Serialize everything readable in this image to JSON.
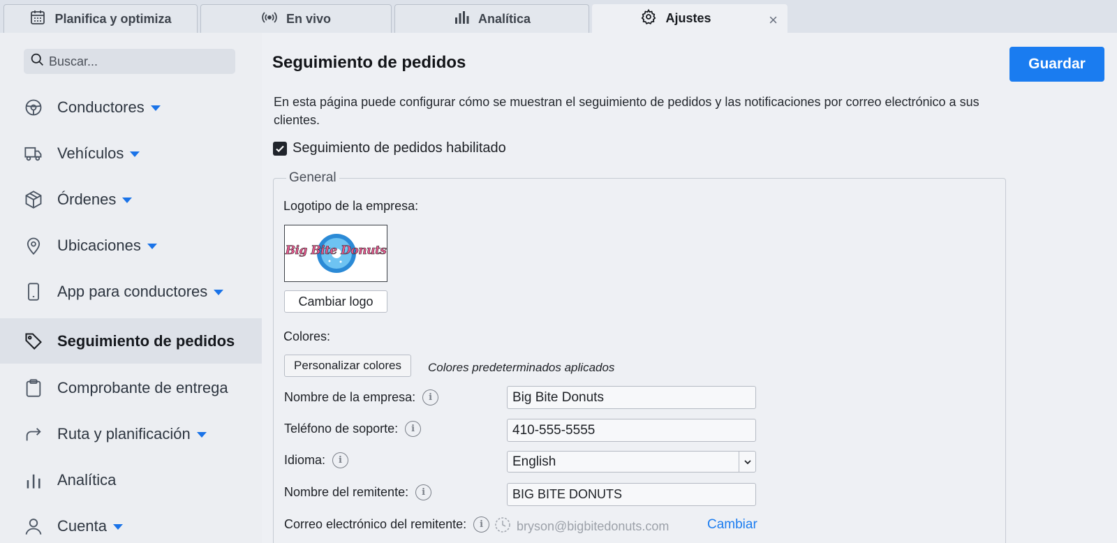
{
  "tabs": [
    {
      "label": "Planifica y optimiza",
      "icon": "calendar-icon"
    },
    {
      "label": "En vivo",
      "icon": "broadcast-icon"
    },
    {
      "label": "Analítica",
      "icon": "bar-chart-icon"
    },
    {
      "label": "Ajustes",
      "icon": "gear-icon",
      "active": true,
      "close": "×"
    }
  ],
  "sidebar": {
    "search_placeholder": "Buscar...",
    "items": [
      {
        "label": "Conductores",
        "icon": "wheel-icon",
        "caret": true
      },
      {
        "label": "Vehículos",
        "icon": "truck-icon",
        "caret": true
      },
      {
        "label": "Órdenes",
        "icon": "box-icon",
        "caret": true
      },
      {
        "label": "Ubicaciones",
        "icon": "map-pin-icon",
        "caret": true
      },
      {
        "label": "App para conductores",
        "icon": "phone-icon",
        "caret": true
      },
      {
        "label": "Seguimiento de pedidos",
        "icon": "tag-icon",
        "active": true
      },
      {
        "label": "Comprobante de entrega",
        "icon": "clipboard-icon"
      },
      {
        "label": "Ruta y planificación",
        "icon": "route-arrow-icon",
        "caret": true
      },
      {
        "label": "Analítica",
        "icon": "bar-chart-icon"
      },
      {
        "label": "Cuenta",
        "icon": "user-icon",
        "caret": true
      }
    ]
  },
  "main": {
    "title": "Seguimiento de pedidos",
    "save_label": "Guardar",
    "description": "En esta página puede configurar cómo se muestran el seguimiento de pedidos y las notificaciones por correo electrónico a sus clientes.",
    "enable_label": "Seguimiento de pedidos habilitado",
    "enabled": true,
    "general": {
      "legend": "General",
      "logo_label": "Logotipo de la empresa:",
      "logo_text": "Big Bite Donuts",
      "change_logo_label": "Cambiar logo",
      "colors_label": "Colores:",
      "customize_colors_label": "Personalizar colores",
      "colors_note": "Colores predeterminados aplicados",
      "company_name_label": "Nombre de la empresa:",
      "company_name_value": "Big Bite Donuts",
      "support_phone_label": "Teléfono de soporte:",
      "support_phone_value": "410-555-5555",
      "language_label": "Idioma:",
      "language_value": "English",
      "sender_name_label": "Nombre del remitente:",
      "sender_name_value": "BIG BITE DONUTS",
      "sender_email_label": "Correo electrónico del remitente:",
      "sender_email_value": "bryson@bigbitedonuts.com",
      "change_label": "Cambiar"
    }
  },
  "colors": {
    "accent": "#1a7cf0",
    "sidebar_active": "#dde1e8"
  }
}
